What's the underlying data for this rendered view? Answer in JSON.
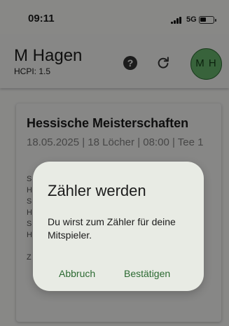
{
  "status_bar": {
    "time": "09:11",
    "network": "5G",
    "battery_level": 0.45
  },
  "header": {
    "user_name": "M Hagen",
    "hcpi": "HCPI: 1.5",
    "avatar_initials": "M H",
    "help_glyph": "?"
  },
  "event": {
    "title": "Hessische Meisterschaften",
    "meta": "18.05.2025 | 18 Löcher | 08:00 | Tee 1",
    "player_initials": [
      "S",
      "H",
      "S",
      "H",
      "S",
      "H",
      "",
      "Z"
    ]
  },
  "dialog": {
    "title": "Zähler werden",
    "message": "Du wirst zum Zähler für deine Mitspieler.",
    "cancel_label": "Abbruch",
    "confirm_label": "Bestätigen"
  },
  "colors": {
    "accent": "#2c6a32",
    "avatar_bg": "#67b46c",
    "dialog_bg": "#e8ebe4"
  },
  "icons": [
    "help-icon",
    "refresh-icon",
    "signal-icon",
    "battery-icon"
  ]
}
